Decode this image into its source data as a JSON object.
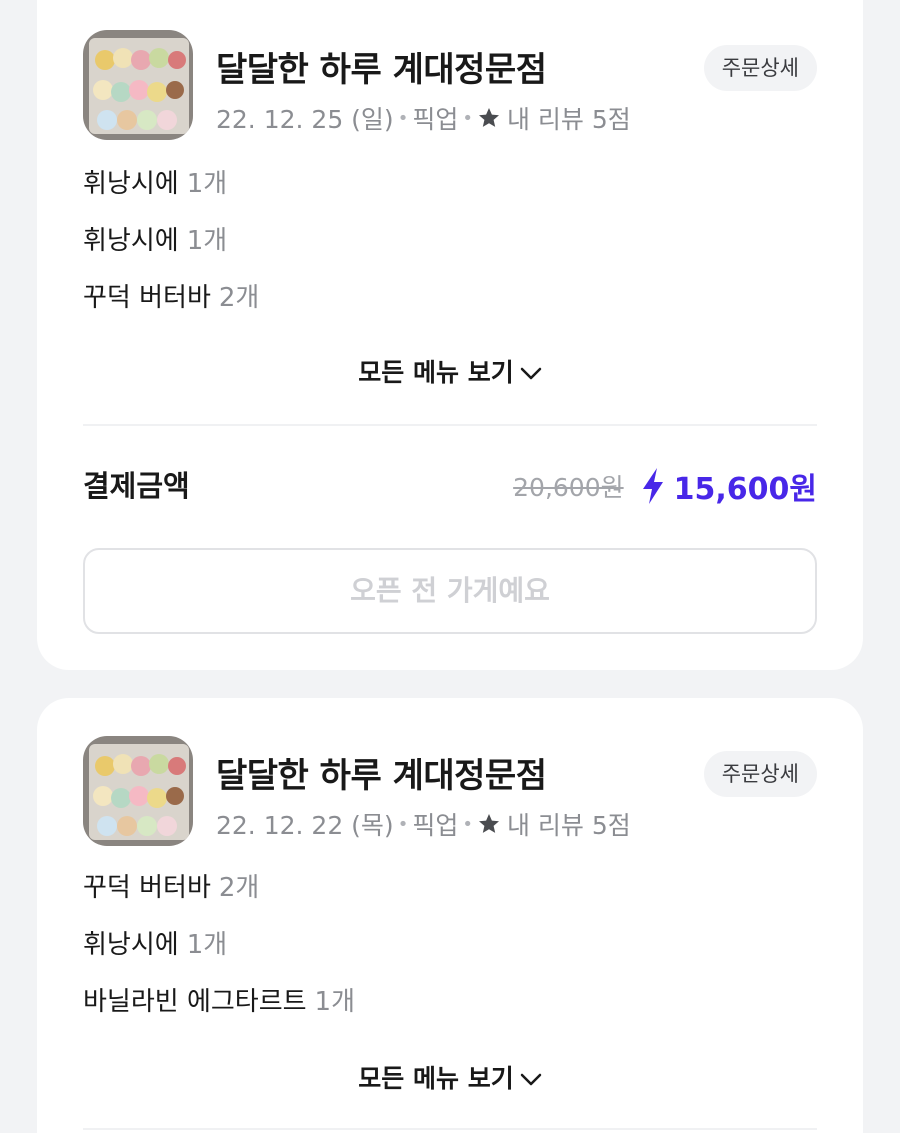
{
  "orders": [
    {
      "store_name": "달달한 하루 계대정문점",
      "detail_label": "주문상세",
      "date": "22. 12. 25 (일)",
      "order_type": "픽업",
      "review": "내 리뷰 5점",
      "items": [
        {
          "name": "휘낭시에",
          "qty": "1개"
        },
        {
          "name": "휘낭시에",
          "qty": "1개"
        },
        {
          "name": "꾸덕 버터바",
          "qty": "2개"
        }
      ],
      "more_label": "모든 메뉴 보기",
      "payment_label": "결제금액",
      "original_price": "20,600원",
      "final_price": "15,600원",
      "status_button": "오픈 전 가게예요"
    },
    {
      "store_name": "달달한 하루 계대정문점",
      "detail_label": "주문상세",
      "date": "22. 12. 22 (목)",
      "order_type": "픽업",
      "review": "내 리뷰 5점",
      "items": [
        {
          "name": "꾸덕 버터바",
          "qty": "2개"
        },
        {
          "name": "휘낭시에",
          "qty": "1개"
        },
        {
          "name": "바닐라빈 에그타르트",
          "qty": "1개"
        }
      ],
      "more_label": "모든 메뉴 보기"
    }
  ],
  "icons": {
    "star": "star-icon",
    "bolt": "lightning-icon",
    "chevron": "chevron-down-icon"
  },
  "colors": {
    "accent": "#4827e8",
    "muted": "#8b8d92",
    "background": "#f2f3f5"
  }
}
